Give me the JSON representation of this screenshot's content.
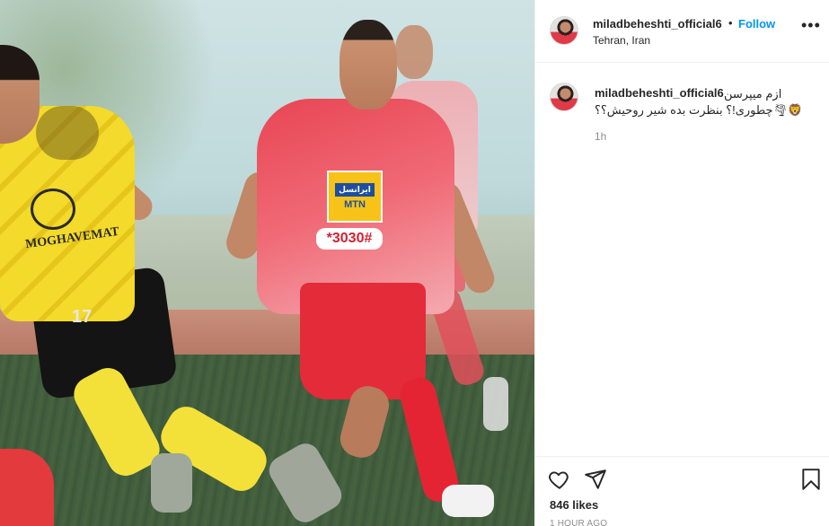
{
  "post": {
    "photo_alt": "",
    "sponsor": {
      "brand": "ایرانسل",
      "mtn": "MTN",
      "code": "*3030#"
    },
    "yellow_team": {
      "text": "MOGHAVEMAT",
      "number": "17"
    }
  },
  "header": {
    "username": "miladbeheshti_official6",
    "separator": "•",
    "follow_label": "Follow",
    "location": "Tehran, Iran",
    "more_label": "•••",
    "avatar_icon": "avatar"
  },
  "caption": {
    "username": "miladbeheshti_official6",
    "text_line1": "ازم میپرسن",
    "text_line2": "🦁🌪چطوری!؟ بنظرت بده شیر روحیش؟؟",
    "time": "1h"
  },
  "actions": {
    "like_icon": "heart-icon",
    "share_icon": "paper-plane-icon",
    "save_icon": "bookmark-icon"
  },
  "stats": {
    "likes": "846 likes",
    "ago": "1 HOUR AGO"
  },
  "colors": {
    "link_blue": "#0095f6",
    "text": "#262626",
    "muted": "#8e8e8e",
    "border": "#efefef"
  }
}
